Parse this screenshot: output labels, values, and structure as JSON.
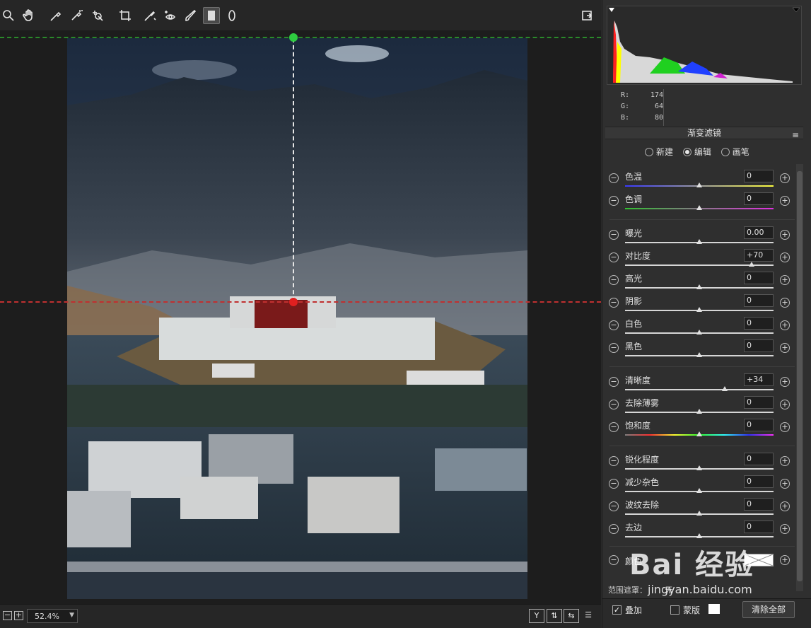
{
  "toolbar": {
    "tools": [
      "zoom-icon",
      "hand-icon",
      "white-balance-icon",
      "color-sampler-icon",
      "targeted-adjust-icon",
      "crop-icon",
      "spot-removal-icon",
      "red-eye-icon",
      "brush-icon",
      "graduated-filter-icon",
      "radial-filter-icon"
    ],
    "active_tool": "graduated-filter-icon"
  },
  "colors": {
    "guide_top": "#2a8a2a",
    "guide_bottom": "#c03030",
    "pin_top": "#2ecc40",
    "pin_bottom": "#e02020"
  },
  "bottombar": {
    "zoom_value": "52.4%",
    "view_buttons": [
      "Y",
      "⇅",
      "⇆",
      "☰"
    ]
  },
  "histogram": {
    "readout": {
      "r_label": "R:",
      "r": "174",
      "g_label": "G:",
      "g": "64",
      "b_label": "B:",
      "b": "80"
    }
  },
  "panel": {
    "title": "渐变滤镜",
    "modes": [
      {
        "label": "新建",
        "selected": false
      },
      {
        "label": "编辑",
        "selected": true
      },
      {
        "label": "画笔",
        "selected": false
      }
    ],
    "sliders": [
      {
        "key": "temp",
        "label": "色温",
        "value": "0",
        "pos": 0.5
      },
      {
        "key": "tint",
        "label": "色调",
        "value": "0",
        "pos": 0.5
      },
      {
        "key": "exposure",
        "label": "曝光",
        "value": "0.00",
        "pos": 0.5
      },
      {
        "key": "contrast",
        "label": "对比度",
        "value": "+70",
        "pos": 0.85
      },
      {
        "key": "highlights",
        "label": "高光",
        "value": "0",
        "pos": 0.5
      },
      {
        "key": "shadows",
        "label": "阴影",
        "value": "0",
        "pos": 0.5
      },
      {
        "key": "whites",
        "label": "白色",
        "value": "0",
        "pos": 0.5
      },
      {
        "key": "blacks",
        "label": "黑色",
        "value": "0",
        "pos": 0.5
      },
      {
        "key": "clarity",
        "label": "清晰度",
        "value": "+34",
        "pos": 0.67
      },
      {
        "key": "dehaze",
        "label": "去除薄雾",
        "value": "0",
        "pos": 0.5
      },
      {
        "key": "saturation",
        "label": "饱和度",
        "value": "0",
        "pos": 0.5
      },
      {
        "key": "sharpness",
        "label": "锐化程度",
        "value": "0",
        "pos": 0.5
      },
      {
        "key": "noise",
        "label": "减少杂色",
        "value": "0",
        "pos": 0.5
      },
      {
        "key": "moire",
        "label": "波纹去除",
        "value": "0",
        "pos": 0.5
      },
      {
        "key": "defringe",
        "label": "去边",
        "value": "0",
        "pos": 0.5
      }
    ],
    "color_label": "颜色",
    "range_mask_label": "范围遮罩：",
    "range_mask_value": "无",
    "overlay_label": "叠加",
    "mask_label": "蒙版",
    "clear_all": "清除全部"
  },
  "watermark": {
    "brand": "Bai 经验",
    "url": "jingyan.baidu.com"
  }
}
